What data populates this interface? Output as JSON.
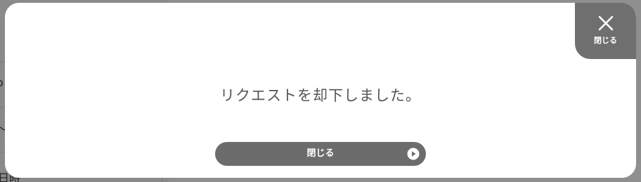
{
  "background": {
    "fragments": [
      "(",
      "o",
      "〜",
      "日時"
    ]
  },
  "modal": {
    "message": "リクエストを却下しました。",
    "corner_close": {
      "icon": "close-icon",
      "label": "閉じる"
    },
    "close_button": {
      "label": "閉じる",
      "icon": "play-circle-icon"
    }
  },
  "colors": {
    "overlay": "#8f8f8f",
    "modal_bg": "#ffffff",
    "button_bg": "#6c6c6c",
    "corner_bg": "#6f6f6f",
    "message_text": "#555555"
  }
}
